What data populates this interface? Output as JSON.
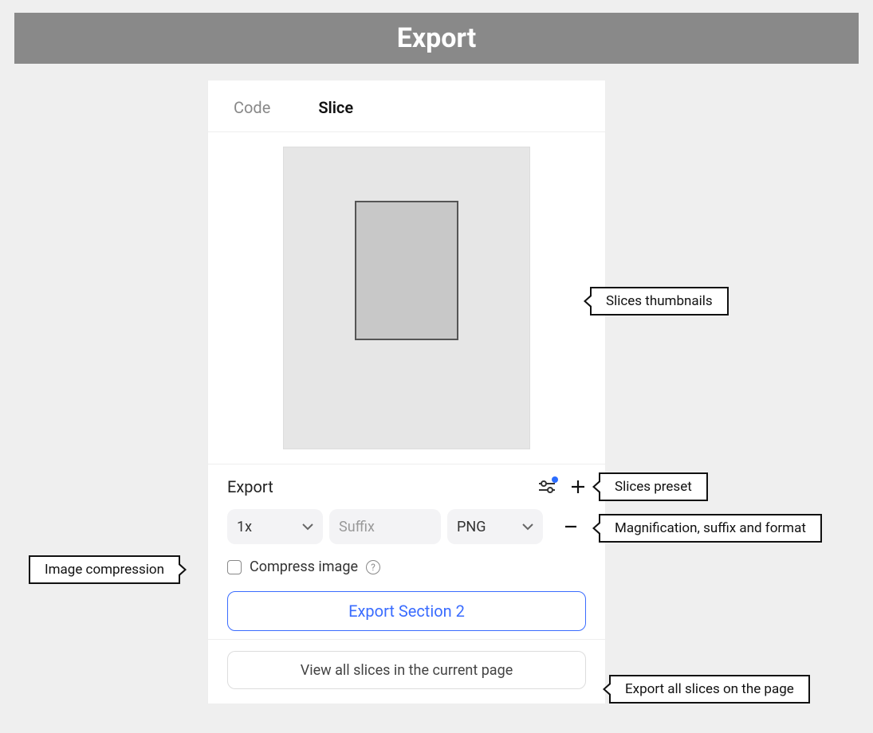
{
  "header": {
    "title": "Export"
  },
  "tabs": {
    "code": "Code",
    "slice": "Slice",
    "active": "slice"
  },
  "export": {
    "section_title": "Export",
    "scale": "1x",
    "suffix_placeholder": "Suffix",
    "format": "PNG",
    "compress_label": "Compress image",
    "export_button": "Export Section 2",
    "view_all_button": "View all slices in the current page"
  },
  "callouts": {
    "thumbnails": "Slices thumbnails",
    "preset": "Slices preset",
    "row": "Magnification, suffix and format",
    "compression": "Image compression",
    "all_slices": "Export all slices on the page"
  }
}
